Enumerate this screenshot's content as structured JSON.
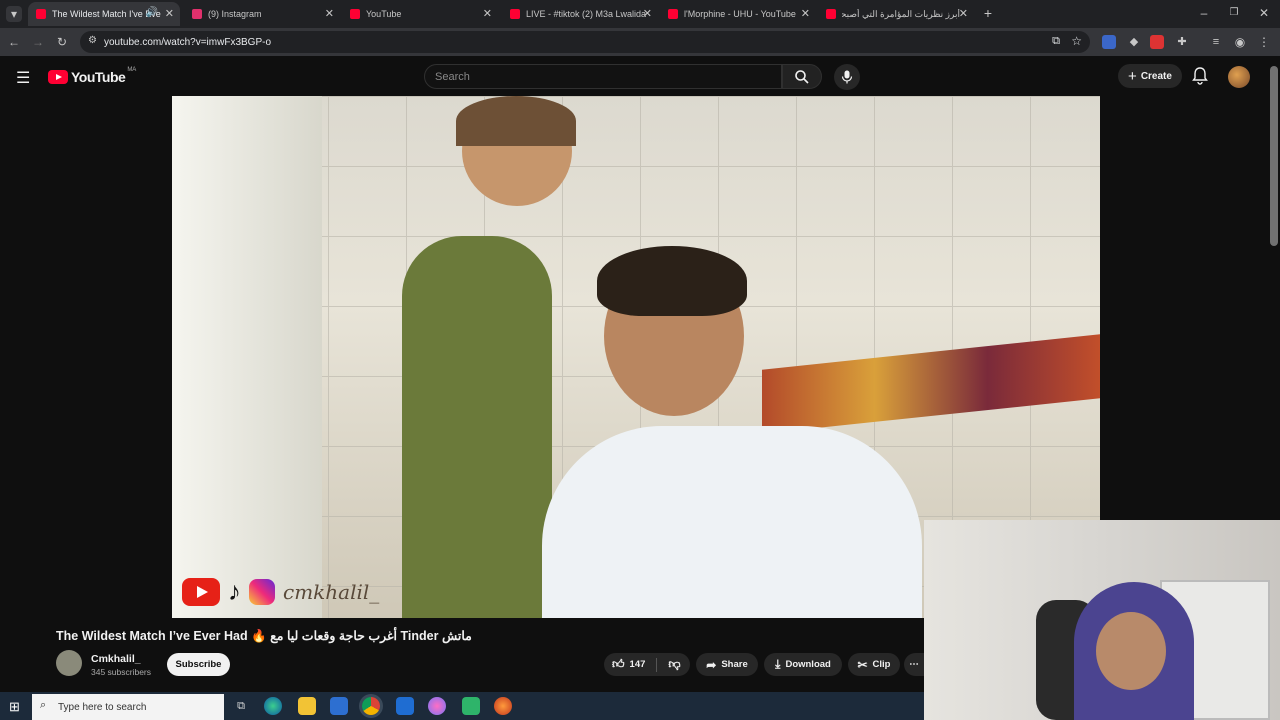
{
  "browser": {
    "tabs": [
      {
        "label": "The Wildest Match I've Eve",
        "color": "#ff0033",
        "active": true
      },
      {
        "label": "(9) Instagram",
        "color": "#e1306c",
        "active": false
      },
      {
        "label": "YouTube",
        "color": "#ff0033",
        "active": false
      },
      {
        "label": "LIVE - #tiktok (2) M3a Lwalida",
        "color": "#ff0033",
        "active": false
      },
      {
        "label": "l'Morphine - UHU - YouTube",
        "color": "#ff0033",
        "active": false
      },
      {
        "label": "أبرز نظريات المؤامرة التي أصبحت",
        "color": "#ff0033",
        "active": false
      }
    ],
    "url": "youtube.com/watch?v=imwFx3BGP-o"
  },
  "youtube": {
    "logo_text": "YouTube",
    "country_code": "MA",
    "search_placeholder": "Search",
    "create_label": "Create",
    "video": {
      "title": "The Wildest Match I’ve Ever Had 🔥 أغرب حاجة وقعات ليا مع Tinder ماتش",
      "watermark_handle": "cmkhalil_",
      "channel_name": "Cmkhalil_",
      "subscribers": "345 subscribers",
      "subscribe_label": "Subscribe",
      "likes": "147",
      "share_label": "Share",
      "download_label": "Download",
      "clip_label": "Clip"
    }
  },
  "taskbar": {
    "search_placeholder": "Type here to search"
  },
  "colors": {
    "yt_red": "#ff0033",
    "bg": "#0f0f0f",
    "chip": "#272727"
  }
}
